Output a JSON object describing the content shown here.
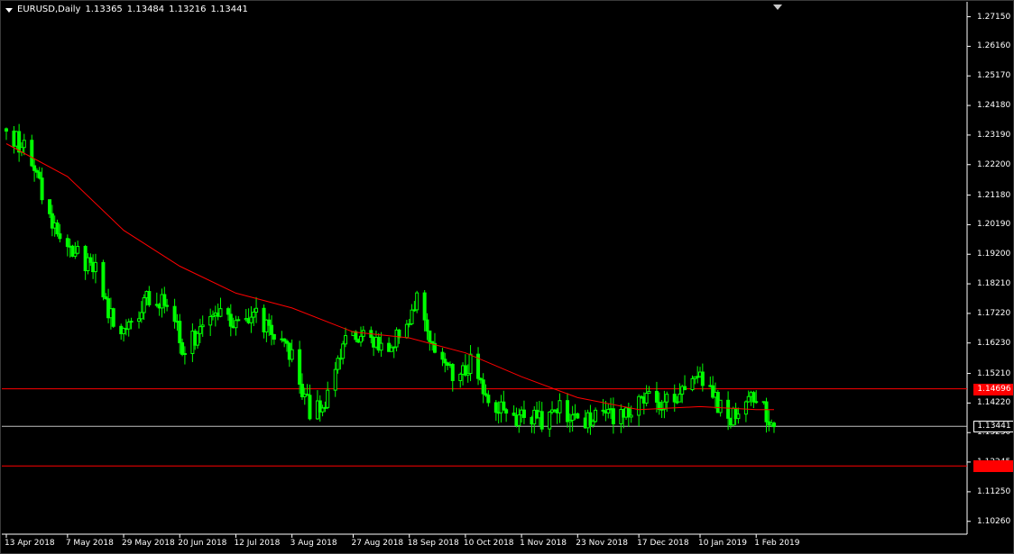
{
  "window": {
    "menu_icon": "triangle-down-icon",
    "shift_marker_icon": "chart-shift-triangle-icon"
  },
  "header": {
    "symbol": "EURUSD",
    "timeframe": "Daily",
    "title": "EURUSD,Daily",
    "open": "1.13365",
    "high": "1.13484",
    "low": "1.13216",
    "close": "1.13441"
  },
  "colors": {
    "background": "#000000",
    "candle": "#00ff00",
    "moving_average": "#ff0000",
    "horizontal_line": "#ff0000",
    "current_price_line": "#c0c0c0",
    "axis_text": "#ffffff",
    "axis_line": "#ffffff",
    "price_tag_red": "#ff0000"
  },
  "chart_data": {
    "type": "candlestick",
    "title": "EURUSD,Daily",
    "symbol": "EURUSD",
    "timeframe": "Daily",
    "grid": false,
    "legend": "none",
    "x_range": [
      "13 Apr 2018",
      "8 Feb 2019"
    ],
    "y_range": [
      1.0983,
      1.2765
    ],
    "y_ticks": [
      "1.27150",
      "1.26160",
      "1.25170",
      "1.24180",
      "1.23190",
      "1.22200",
      "1.21180",
      "1.20190",
      "1.19200",
      "1.18210",
      "1.17220",
      "1.16230",
      "1.15210",
      "1.14220",
      "1.13230",
      "1.12245",
      "1.11250",
      "1.10260"
    ],
    "x_ticks": [
      {
        "label": "13 Apr 2018",
        "date": "2018-04-13"
      },
      {
        "label": "7 May 2018",
        "date": "2018-05-07"
      },
      {
        "label": "29 May 2018",
        "date": "2018-05-29"
      },
      {
        "label": "20 Jun 2018",
        "date": "2018-06-20"
      },
      {
        "label": "12 Jul 2018",
        "date": "2018-07-12"
      },
      {
        "label": "3 Aug 2018",
        "date": "2018-08-03"
      },
      {
        "label": "27 Aug 2018",
        "date": "2018-08-27"
      },
      {
        "label": "18 Sep 2018",
        "date": "2018-09-18"
      },
      {
        "label": "10 Oct 2018",
        "date": "2018-10-10"
      },
      {
        "label": "1 Nov 2018",
        "date": "2018-11-01"
      },
      {
        "label": "23 Nov 2018",
        "date": "2018-11-23"
      },
      {
        "label": "17 Dec 2018",
        "date": "2018-12-17"
      },
      {
        "label": "10 Jan 2019",
        "date": "2019-01-10"
      },
      {
        "label": "1 Feb 2019",
        "date": "2019-02-01"
      }
    ],
    "series": [
      {
        "kind": "candles",
        "color": "#00ff00",
        "points": [
          {
            "date": "2018-04-13",
            "c": 1.234
          },
          {
            "date": "2018-04-20",
            "c": 1.228
          },
          {
            "date": "2018-04-27",
            "c": 1.213
          },
          {
            "date": "2018-05-04",
            "c": 1.197
          },
          {
            "date": "2018-05-11",
            "c": 1.192
          },
          {
            "date": "2018-05-18",
            "c": 1.187
          },
          {
            "date": "2018-05-25",
            "c": 1.168
          },
          {
            "date": "2018-06-01",
            "c": 1.168
          },
          {
            "date": "2018-06-08",
            "c": 1.178
          },
          {
            "date": "2018-06-15",
            "c": 1.176
          },
          {
            "date": "2018-06-22",
            "c": 1.159
          },
          {
            "date": "2018-06-29",
            "c": 1.168
          },
          {
            "date": "2018-07-06",
            "c": 1.173
          },
          {
            "date": "2018-07-13",
            "c": 1.168
          },
          {
            "date": "2018-07-20",
            "c": 1.171
          },
          {
            "date": "2018-07-27",
            "c": 1.165
          },
          {
            "date": "2018-08-03",
            "c": 1.157
          },
          {
            "date": "2018-08-10",
            "c": 1.14
          },
          {
            "date": "2018-08-17",
            "c": 1.144
          },
          {
            "date": "2018-08-24",
            "c": 1.162
          },
          {
            "date": "2018-08-31",
            "c": 1.165
          },
          {
            "date": "2018-09-07",
            "c": 1.161
          },
          {
            "date": "2018-09-14",
            "c": 1.165
          },
          {
            "date": "2018-09-21",
            "c": 1.176
          },
          {
            "date": "2018-09-28",
            "c": 1.162
          },
          {
            "date": "2018-10-05",
            "c": 1.152
          },
          {
            "date": "2018-10-12",
            "c": 1.156
          },
          {
            "date": "2018-10-19",
            "c": 1.145
          },
          {
            "date": "2018-10-26",
            "c": 1.137
          },
          {
            "date": "2018-11-02",
            "c": 1.138
          },
          {
            "date": "2018-11-09",
            "c": 1.136
          },
          {
            "date": "2018-11-16",
            "c": 1.141
          },
          {
            "date": "2018-11-23",
            "c": 1.135
          },
          {
            "date": "2018-11-30",
            "c": 1.139
          },
          {
            "date": "2018-12-07",
            "c": 1.138
          },
          {
            "date": "2018-12-14",
            "c": 1.14
          },
          {
            "date": "2018-12-21",
            "c": 1.143
          },
          {
            "date": "2018-12-28",
            "c": 1.143
          },
          {
            "date": "2019-01-04",
            "c": 1.147
          },
          {
            "date": "2019-01-11",
            "c": 1.15
          },
          {
            "date": "2019-01-18",
            "c": 1.14
          },
          {
            "date": "2019-01-25",
            "c": 1.137
          },
          {
            "date": "2019-02-01",
            "c": 1.146
          },
          {
            "date": "2019-02-08",
            "c": 1.134
          }
        ]
      },
      {
        "kind": "moving-average",
        "color": "#ff0000",
        "points": [
          {
            "date": "2018-04-13",
            "v": 1.229
          },
          {
            "date": "2018-05-07",
            "v": 1.218
          },
          {
            "date": "2018-05-29",
            "v": 1.2
          },
          {
            "date": "2018-06-20",
            "v": 1.188
          },
          {
            "date": "2018-07-12",
            "v": 1.179
          },
          {
            "date": "2018-08-03",
            "v": 1.174
          },
          {
            "date": "2018-08-27",
            "v": 1.166
          },
          {
            "date": "2018-09-18",
            "v": 1.164
          },
          {
            "date": "2018-10-10",
            "v": 1.159
          },
          {
            "date": "2018-11-01",
            "v": 1.151
          },
          {
            "date": "2018-11-23",
            "v": 1.144
          },
          {
            "date": "2018-12-17",
            "v": 1.14
          },
          {
            "date": "2019-01-10",
            "v": 1.141
          },
          {
            "date": "2019-02-01",
            "v": 1.14
          },
          {
            "date": "2019-02-08",
            "v": 1.14
          }
        ]
      }
    ],
    "horizontal_lines": [
      {
        "label": "1.14696",
        "value": 1.14696,
        "color": "#ff0000"
      },
      {
        "label": "1.13441",
        "value": 1.13441,
        "color": "#c0c0c0"
      },
      {
        "label": "1.12115",
        "value": 1.12115,
        "color": "#ff0000"
      }
    ],
    "price_tags": [
      {
        "label": "1.14696",
        "value": 1.14696,
        "color": "#ff0000",
        "text_color": "#ffffff",
        "style": "filled"
      },
      {
        "label": "1.13441",
        "value": 1.13441,
        "color": "#ffffff",
        "text_color": "#000000",
        "style": "outlined"
      },
      {
        "label": "1.12115",
        "value": 1.12115,
        "color": "#ff0000",
        "text_color": "#ff0000",
        "style": "filled"
      }
    ]
  }
}
